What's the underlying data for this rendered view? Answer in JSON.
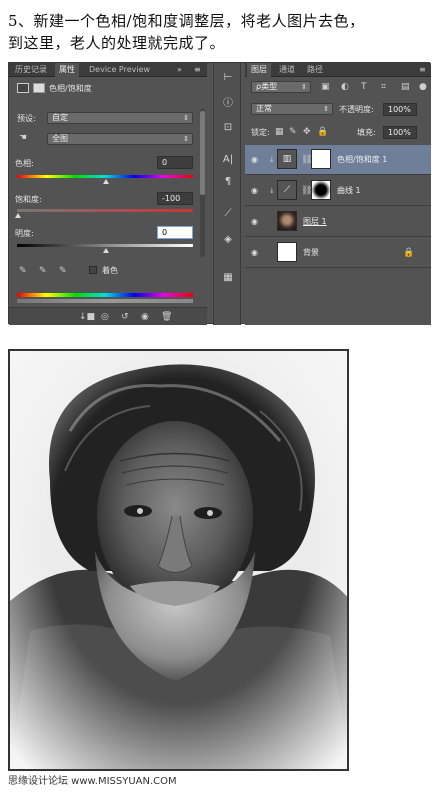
{
  "caption": {
    "line1": "5、新建一个色相/饱和度调整层，将老人图片去色，",
    "line2": "到这里，老人的处理就完成了。"
  },
  "properties_panel": {
    "tabs": [
      "历史记录",
      "属性",
      "Device Preview"
    ],
    "active_tab": "属性",
    "title": "色相/饱和度",
    "preset_label": "预设:",
    "preset_value": "自定",
    "channel_value": "全图",
    "hue_label": "色相:",
    "hue_value": "0",
    "saturation_label": "饱和度:",
    "saturation_value": "-100",
    "lightness_label": "明度:",
    "lightness_value": "0",
    "colorize_label": "着色",
    "adjustments": {
      "hue": 0,
      "saturation": -100,
      "lightness": 0
    }
  },
  "layers_panel": {
    "tabs": [
      "图层",
      "通道",
      "路径"
    ],
    "filter_label": "ρ类型",
    "blend_mode": "正常",
    "opacity_label": "不透明度:",
    "opacity_value": "100%",
    "lock_label": "锁定:",
    "fill_label": "填充:",
    "fill_value": "100%",
    "layers": [
      {
        "name": "色相/饱和度 1",
        "active": true
      },
      {
        "name": "曲线 1",
        "active": false
      },
      {
        "name": "图层 1",
        "active": false
      },
      {
        "name": "背景",
        "active": false
      }
    ]
  },
  "footer": {
    "watermark": "思缘设计论坛 www.MISSYUAN.COM"
  },
  "colors": {
    "panel_bg": "#535353",
    "active_layer": "#6f7f99",
    "tab_bg": "#3c3c3c"
  }
}
